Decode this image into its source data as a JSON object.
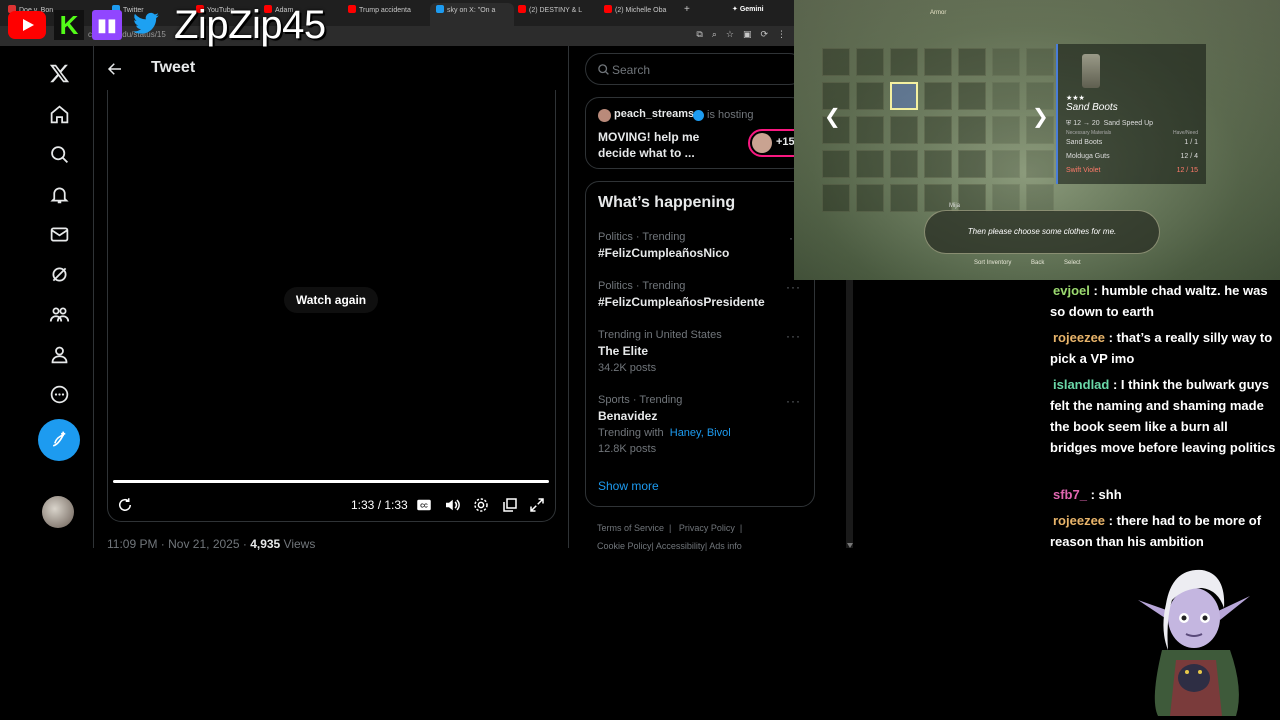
{
  "browser": {
    "tabs": [
      {
        "label": "Doe v. Bon",
        "color": "#d33"
      },
      {
        "label": "Twitter",
        "color": "#1d9bf0"
      },
      {
        "label": "YouTube",
        "color": "#f00"
      },
      {
        "label": "Adam",
        "color": "#f00"
      },
      {
        "label": "Trump accidenta",
        "color": "#f00"
      },
      {
        "label": "sky on X: \"On a",
        "color": "#1d9bf0"
      },
      {
        "label": "(2) DESTINY & L",
        "color": "#f00"
      },
      {
        "label": "(2) Michelle Oba",
        "color": "#f00"
      },
      {
        "label": "Gemini",
        "color": "#8ab4f8"
      }
    ],
    "url_fragment": "com/leajedu/status/15"
  },
  "overlay": {
    "channel_name": "ZipZip45"
  },
  "left_nav": {
    "items": [
      "x-logo-icon",
      "home-icon",
      "explore-icon",
      "notifications-icon",
      "messages-icon",
      "grok-icon",
      "communities-icon",
      "profile-icon",
      "more-icon"
    ]
  },
  "tweet": {
    "header_title": "Tweet",
    "watch_again_label": "Watch again",
    "time_display": "1:33 / 1:33",
    "posted_time": "11:09 PM · Nov 21, 2025 · ",
    "views_count": "4,935",
    "views_label": " Views"
  },
  "sidebar": {
    "search_placeholder": "Search",
    "host": {
      "name": "peach_streams",
      "suffix": "is hosting",
      "text": "MOVING! help me decide what to ...",
      "listener_count": "+15"
    },
    "trends_title": "What’s happening",
    "trends": [
      {
        "context": "Politics · Trending",
        "name": "#FelizCumpleañosNico",
        "posts": ""
      },
      {
        "context": "Politics · Trending",
        "name": "#FelizCumpleañosPresidente",
        "posts": ""
      },
      {
        "context": "Trending in United States",
        "name": "The Elite",
        "posts": "34.2K posts"
      },
      {
        "context": "Sports · Trending",
        "name": "Benavidez",
        "trending_with_label": "Trending with",
        "trending_with_links": "Haney, Bivol",
        "posts": "12.8K posts"
      }
    ],
    "show_more": "Show more",
    "footer_links": [
      "Terms of Service",
      "Privacy Policy",
      "Cookie Policy",
      "Accessibility",
      "Ads info"
    ]
  },
  "game": {
    "header": "Armor",
    "item_name": "Sand Boots",
    "item_stars": "★★★",
    "stats": {
      "defense": "12",
      "arrow": "→",
      "next": "20",
      "effect": "Sand Speed Up"
    },
    "materials_header": "Necessary Materials",
    "have_header": "Have/Need",
    "materials": [
      {
        "name": "Sand Boots",
        "qty": "1 / 1"
      },
      {
        "name": "Molduga Guts",
        "qty": "12 / 4"
      },
      {
        "name": "Swift Violet",
        "qty": "12 / 15"
      }
    ],
    "dialog_speaker": "Mija",
    "dialog_text": "Then please choose some clothes for me.",
    "footer_prompts": [
      "Sort Inventory",
      "Back",
      "Select"
    ]
  },
  "chat": {
    "messages": [
      {
        "user": "evjoel",
        "color": "#9bd96f",
        "text": "humble chad waltz. he was so down to earth"
      },
      {
        "user": "rojeezee",
        "color": "#e8b46a",
        "text": "that’s a really silly way to pick a VP imo"
      },
      {
        "user": "islandlad",
        "color": "#6ad8a8",
        "text": "I think the bulwark guys felt the naming and shaming made the book seem like a burn all bridges move before leaving politics"
      },
      {
        "user": "sfb7_",
        "color": "#e066b0",
        "text": "shh"
      },
      {
        "user": "rojeezee",
        "color": "#e8b46a",
        "text": "there had to be more of reason than his ambition"
      }
    ]
  }
}
